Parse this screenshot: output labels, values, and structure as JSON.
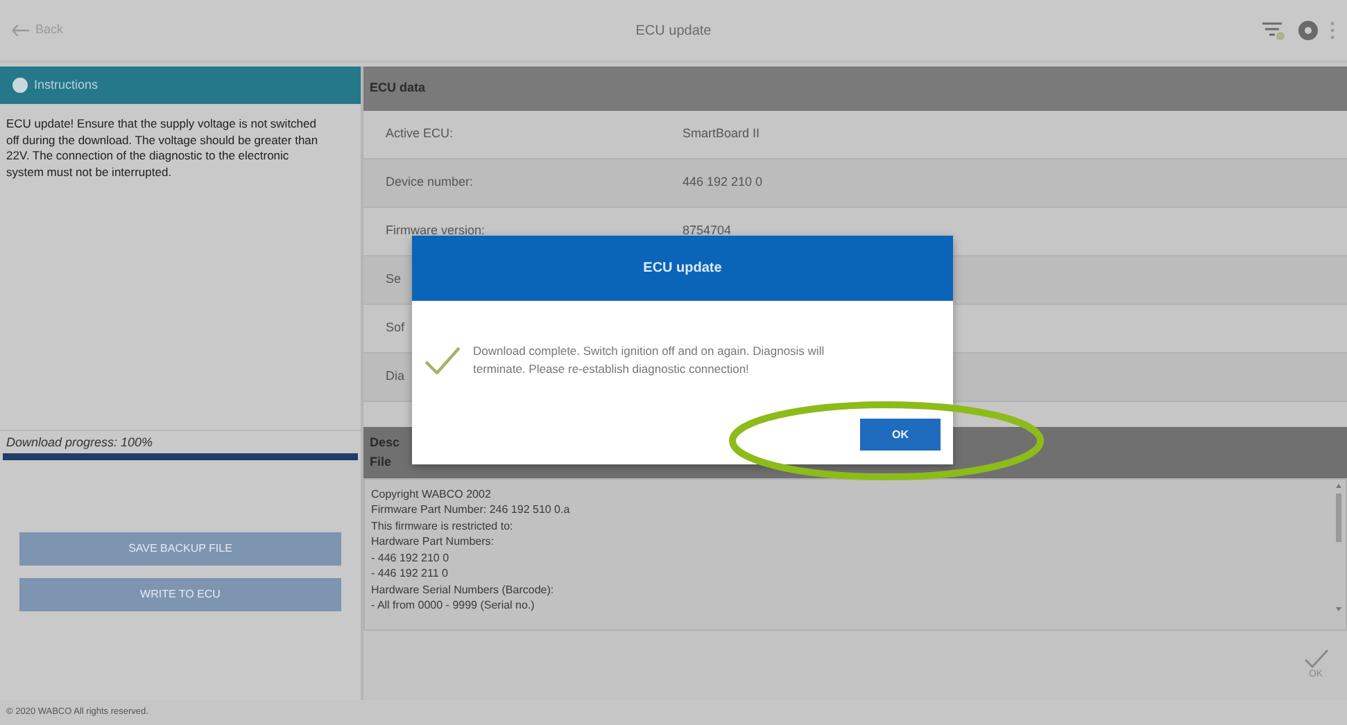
{
  "top_bar": {
    "back_label": "Back",
    "title": "ECU update"
  },
  "instructions": {
    "title": "Instructions",
    "text": "ECU update! Ensure that the supply voltage is not switched off during the download. The voltage should be greater than 22V. The connection of the diagnostic to the electronic system must not be interrupted."
  },
  "progress": {
    "label": "Download progress: 100%",
    "level": 1
  },
  "left_buttons": [
    {
      "label": "SAVE BACKUP FILE",
      "disabled": true
    },
    {
      "label": "WRITE TO ECU",
      "disabled": true
    }
  ],
  "ecu_data": {
    "title": "ECU data",
    "rows": [
      {
        "label": "Active ECU:",
        "value": "SmartBoard II"
      },
      {
        "label": "Device number:",
        "value": "446 192 210 0"
      },
      {
        "label": "Firmware version:",
        "value": "8754704"
      },
      {
        "label": "Se"
      },
      {
        "label": "Sof"
      },
      {
        "label": "Dia"
      }
    ]
  },
  "description": {
    "title": "Desc",
    "subtitle": "File",
    "lines": [
      "Copyright WABCO 2002",
      "Firmware Part Number: 246 192 510 0.a",
      "This firmware is restricted to:",
      "Hardware Part Numbers:",
      "- 446 192 210 0",
      "- 446 192 211 0",
      "Hardware Serial Numbers (Barcode):",
      "- All from 0000 - 9999 (Serial no.)"
    ]
  },
  "confirm_button": {
    "label": "OK"
  },
  "footer": "© 2020 WABCO All rights reserved.",
  "dialog": {
    "title": "ECU update",
    "message": "Download complete. Switch ignition off and on again. Diagnosis will terminate. Please re-establish diagnostic connection!",
    "button": "OK"
  }
}
